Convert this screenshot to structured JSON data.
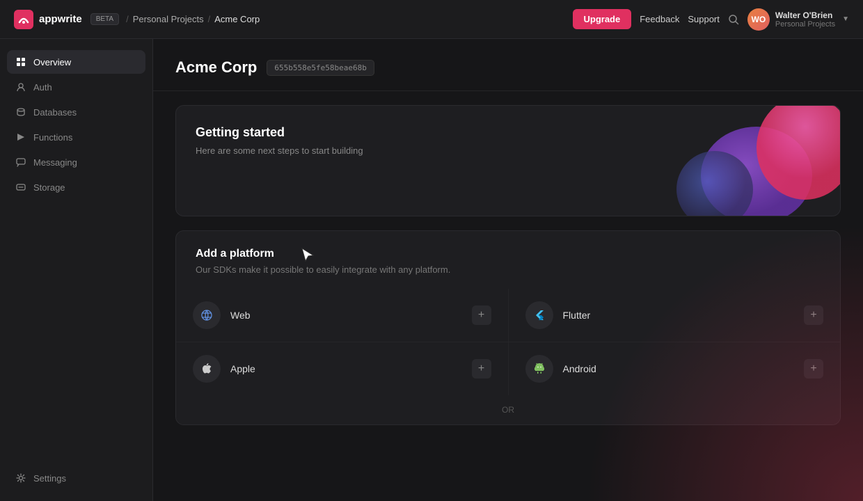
{
  "app": {
    "name": "appwrite",
    "beta_label": "BETA"
  },
  "breadcrumb": {
    "sep": "/",
    "personal_projects": "Personal Projects",
    "current": "Acme Corp"
  },
  "navbar": {
    "upgrade_label": "Upgrade",
    "feedback_label": "Feedback",
    "support_label": "Support",
    "user_initials": "WO",
    "user_name": "Walter O'Brien",
    "user_org": "Personal Projects"
  },
  "sidebar": {
    "items": [
      {
        "id": "overview",
        "label": "Overview",
        "active": true
      },
      {
        "id": "auth",
        "label": "Auth"
      },
      {
        "id": "databases",
        "label": "Databases"
      },
      {
        "id": "functions",
        "label": "Functions"
      },
      {
        "id": "messaging",
        "label": "Messaging"
      },
      {
        "id": "storage",
        "label": "Storage"
      }
    ],
    "bottom": [
      {
        "id": "settings",
        "label": "Settings"
      }
    ]
  },
  "project": {
    "title": "Acme Corp",
    "id": "655b558e5fe58beae68b"
  },
  "getting_started": {
    "title": "Getting started",
    "subtitle": "Here are some next steps to start building"
  },
  "platform": {
    "title": "Add a platform",
    "subtitle": "Our SDKs make it possible to easily integrate with any platform.",
    "items": [
      {
        "id": "web",
        "name": "Web"
      },
      {
        "id": "flutter",
        "name": "Flutter"
      },
      {
        "id": "apple",
        "name": "Apple"
      },
      {
        "id": "android",
        "name": "Android"
      }
    ],
    "add_label": "+",
    "or_label": "OR"
  }
}
